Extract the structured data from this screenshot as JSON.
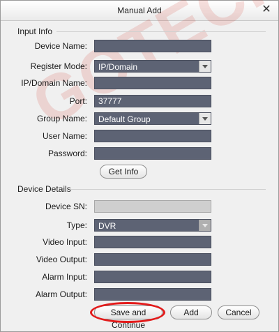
{
  "dialog": {
    "title": "Manual Add",
    "close_label": "✕"
  },
  "watermark": {
    "text": "GOTECH"
  },
  "input_info": {
    "header": "Input Info",
    "device_name": {
      "label": "Device Name:",
      "value": ""
    },
    "register_mode": {
      "label": "Register Mode:",
      "value": "IP/Domain"
    },
    "ip_domain_name": {
      "label": "IP/Domain Name:",
      "value": ""
    },
    "port": {
      "label": "Port:",
      "value": "37777"
    },
    "group_name": {
      "label": "Group Name:",
      "value": "Default Group"
    },
    "user_name": {
      "label": "User Name:",
      "value": ""
    },
    "password": {
      "label": "Password:",
      "value": ""
    },
    "get_info_label": "Get Info"
  },
  "device_details": {
    "header": "Device Details",
    "device_sn": {
      "label": "Device SN:",
      "value": ""
    },
    "type": {
      "label": "Type:",
      "value": "DVR"
    },
    "video_input": {
      "label": "Video Input:",
      "value": ""
    },
    "video_output": {
      "label": "Video Output:",
      "value": ""
    },
    "alarm_input": {
      "label": "Alarm Input:",
      "value": ""
    },
    "alarm_output": {
      "label": "Alarm Output:",
      "value": ""
    }
  },
  "buttons": {
    "save_continue": "Save and Continue",
    "add": "Add",
    "cancel": "Cancel"
  },
  "colors": {
    "field_bg": "#5d6374",
    "highlight": "#e31b1b"
  }
}
